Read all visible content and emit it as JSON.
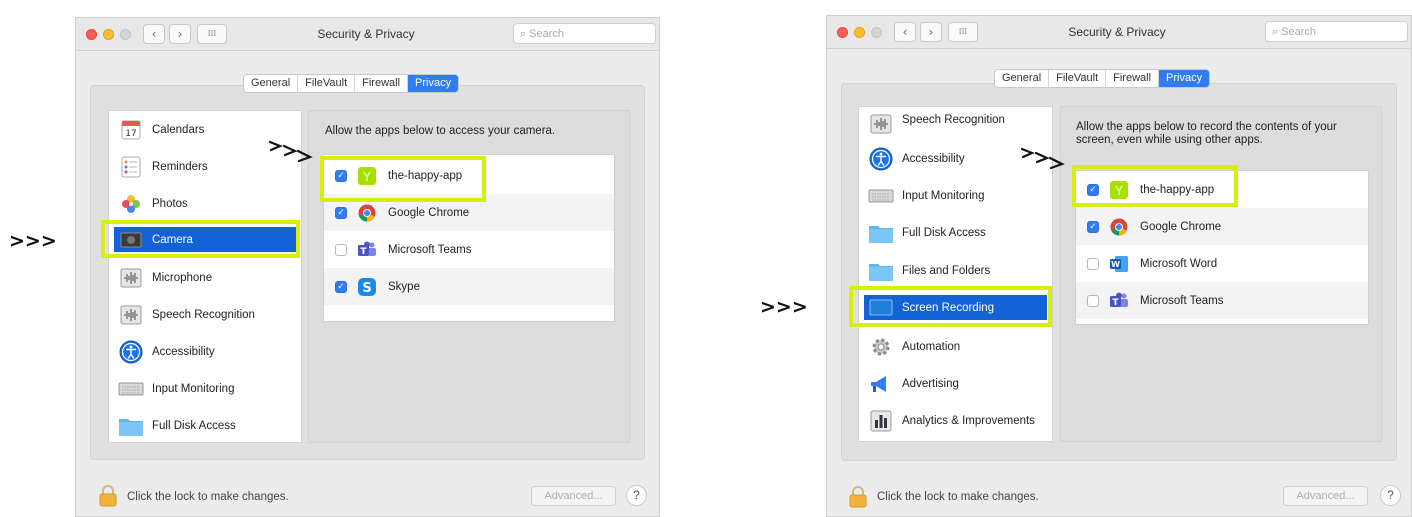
{
  "left": {
    "marker": ">>>",
    "window_title": "Security & Privacy",
    "search_placeholder": "Search",
    "tabs": [
      "General",
      "FileVault",
      "Firewall",
      "Privacy"
    ],
    "active_tab": "Privacy",
    "sidebar": [
      {
        "label": "Calendars",
        "icon": "calendar-icon"
      },
      {
        "label": "Reminders",
        "icon": "reminders-icon"
      },
      {
        "label": "Photos",
        "icon": "photos-icon"
      },
      {
        "label": "Camera",
        "icon": "camera-icon",
        "selected": true
      },
      {
        "label": "Microphone",
        "icon": "microphone-icon"
      },
      {
        "label": "Speech Recognition",
        "icon": "speech-recognition-icon"
      },
      {
        "label": "Accessibility",
        "icon": "accessibility-icon"
      },
      {
        "label": "Input Monitoring",
        "icon": "keyboard-icon"
      },
      {
        "label": "Full Disk Access",
        "icon": "folder-icon"
      }
    ],
    "description": "Allow the apps below to access your camera.",
    "apps": [
      {
        "name": "the-happy-app",
        "checked": true,
        "icon": "happy-app-icon"
      },
      {
        "name": "Google Chrome",
        "checked": true,
        "icon": "chrome-icon"
      },
      {
        "name": "Microsoft Teams",
        "checked": false,
        "icon": "teams-icon"
      },
      {
        "name": "Skype",
        "checked": true,
        "icon": "skype-icon"
      }
    ],
    "lock_text": "Click the lock to make changes.",
    "advanced_label": "Advanced...",
    "help_label": "?"
  },
  "right": {
    "marker": ">>>",
    "window_title": "Security & Privacy",
    "search_placeholder": "Search",
    "tabs": [
      "General",
      "FileVault",
      "Firewall",
      "Privacy"
    ],
    "active_tab": "Privacy",
    "sidebar": [
      {
        "label": "Speech Recognition",
        "icon": "speech-recognition-icon"
      },
      {
        "label": "Accessibility",
        "icon": "accessibility-icon"
      },
      {
        "label": "Input Monitoring",
        "icon": "keyboard-icon"
      },
      {
        "label": "Full Disk Access",
        "icon": "folder-icon"
      },
      {
        "label": "Files and Folders",
        "icon": "folder-icon"
      },
      {
        "label": "Screen Recording",
        "icon": "screen-recording-icon",
        "selected": true
      },
      {
        "label": "Automation",
        "icon": "gear-icon"
      },
      {
        "label": "Advertising",
        "icon": "megaphone-icon"
      },
      {
        "label": "Analytics & Improvements",
        "icon": "analytics-icon"
      }
    ],
    "description": "Allow the apps below to record the contents of your screen, even while using other apps.",
    "apps": [
      {
        "name": "the-happy-app",
        "checked": true,
        "icon": "happy-app-icon"
      },
      {
        "name": "Google Chrome",
        "checked": true,
        "icon": "chrome-icon"
      },
      {
        "name": "Microsoft Word",
        "checked": false,
        "icon": "word-icon"
      },
      {
        "name": "Microsoft Teams",
        "checked": false,
        "icon": "teams-icon"
      }
    ],
    "lock_text": "Click the lock to make changes.",
    "advanced_label": "Advanced...",
    "help_label": "?"
  },
  "colors": {
    "highlight": "#d8ee0c",
    "selection": "#1463d6",
    "accent": "#2f7cf5"
  }
}
